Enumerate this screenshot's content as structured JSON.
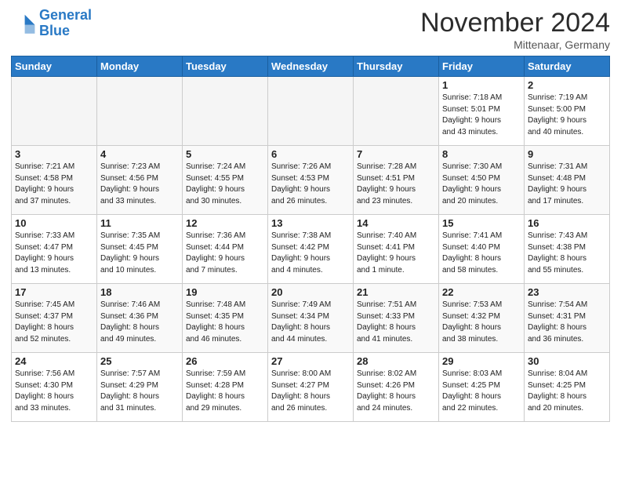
{
  "header": {
    "logo_line1": "General",
    "logo_line2": "Blue",
    "month_title": "November 2024",
    "location": "Mittenaar, Germany"
  },
  "weekdays": [
    "Sunday",
    "Monday",
    "Tuesday",
    "Wednesday",
    "Thursday",
    "Friday",
    "Saturday"
  ],
  "weeks": [
    [
      {
        "day": "",
        "info": ""
      },
      {
        "day": "",
        "info": ""
      },
      {
        "day": "",
        "info": ""
      },
      {
        "day": "",
        "info": ""
      },
      {
        "day": "",
        "info": ""
      },
      {
        "day": "1",
        "info": "Sunrise: 7:18 AM\nSunset: 5:01 PM\nDaylight: 9 hours\nand 43 minutes."
      },
      {
        "day": "2",
        "info": "Sunrise: 7:19 AM\nSunset: 5:00 PM\nDaylight: 9 hours\nand 40 minutes."
      }
    ],
    [
      {
        "day": "3",
        "info": "Sunrise: 7:21 AM\nSunset: 4:58 PM\nDaylight: 9 hours\nand 37 minutes."
      },
      {
        "day": "4",
        "info": "Sunrise: 7:23 AM\nSunset: 4:56 PM\nDaylight: 9 hours\nand 33 minutes."
      },
      {
        "day": "5",
        "info": "Sunrise: 7:24 AM\nSunset: 4:55 PM\nDaylight: 9 hours\nand 30 minutes."
      },
      {
        "day": "6",
        "info": "Sunrise: 7:26 AM\nSunset: 4:53 PM\nDaylight: 9 hours\nand 26 minutes."
      },
      {
        "day": "7",
        "info": "Sunrise: 7:28 AM\nSunset: 4:51 PM\nDaylight: 9 hours\nand 23 minutes."
      },
      {
        "day": "8",
        "info": "Sunrise: 7:30 AM\nSunset: 4:50 PM\nDaylight: 9 hours\nand 20 minutes."
      },
      {
        "day": "9",
        "info": "Sunrise: 7:31 AM\nSunset: 4:48 PM\nDaylight: 9 hours\nand 17 minutes."
      }
    ],
    [
      {
        "day": "10",
        "info": "Sunrise: 7:33 AM\nSunset: 4:47 PM\nDaylight: 9 hours\nand 13 minutes."
      },
      {
        "day": "11",
        "info": "Sunrise: 7:35 AM\nSunset: 4:45 PM\nDaylight: 9 hours\nand 10 minutes."
      },
      {
        "day": "12",
        "info": "Sunrise: 7:36 AM\nSunset: 4:44 PM\nDaylight: 9 hours\nand 7 minutes."
      },
      {
        "day": "13",
        "info": "Sunrise: 7:38 AM\nSunset: 4:42 PM\nDaylight: 9 hours\nand 4 minutes."
      },
      {
        "day": "14",
        "info": "Sunrise: 7:40 AM\nSunset: 4:41 PM\nDaylight: 9 hours\nand 1 minute."
      },
      {
        "day": "15",
        "info": "Sunrise: 7:41 AM\nSunset: 4:40 PM\nDaylight: 8 hours\nand 58 minutes."
      },
      {
        "day": "16",
        "info": "Sunrise: 7:43 AM\nSunset: 4:38 PM\nDaylight: 8 hours\nand 55 minutes."
      }
    ],
    [
      {
        "day": "17",
        "info": "Sunrise: 7:45 AM\nSunset: 4:37 PM\nDaylight: 8 hours\nand 52 minutes."
      },
      {
        "day": "18",
        "info": "Sunrise: 7:46 AM\nSunset: 4:36 PM\nDaylight: 8 hours\nand 49 minutes."
      },
      {
        "day": "19",
        "info": "Sunrise: 7:48 AM\nSunset: 4:35 PM\nDaylight: 8 hours\nand 46 minutes."
      },
      {
        "day": "20",
        "info": "Sunrise: 7:49 AM\nSunset: 4:34 PM\nDaylight: 8 hours\nand 44 minutes."
      },
      {
        "day": "21",
        "info": "Sunrise: 7:51 AM\nSunset: 4:33 PM\nDaylight: 8 hours\nand 41 minutes."
      },
      {
        "day": "22",
        "info": "Sunrise: 7:53 AM\nSunset: 4:32 PM\nDaylight: 8 hours\nand 38 minutes."
      },
      {
        "day": "23",
        "info": "Sunrise: 7:54 AM\nSunset: 4:31 PM\nDaylight: 8 hours\nand 36 minutes."
      }
    ],
    [
      {
        "day": "24",
        "info": "Sunrise: 7:56 AM\nSunset: 4:30 PM\nDaylight: 8 hours\nand 33 minutes."
      },
      {
        "day": "25",
        "info": "Sunrise: 7:57 AM\nSunset: 4:29 PM\nDaylight: 8 hours\nand 31 minutes."
      },
      {
        "day": "26",
        "info": "Sunrise: 7:59 AM\nSunset: 4:28 PM\nDaylight: 8 hours\nand 29 minutes."
      },
      {
        "day": "27",
        "info": "Sunrise: 8:00 AM\nSunset: 4:27 PM\nDaylight: 8 hours\nand 26 minutes."
      },
      {
        "day": "28",
        "info": "Sunrise: 8:02 AM\nSunset: 4:26 PM\nDaylight: 8 hours\nand 24 minutes."
      },
      {
        "day": "29",
        "info": "Sunrise: 8:03 AM\nSunset: 4:25 PM\nDaylight: 8 hours\nand 22 minutes."
      },
      {
        "day": "30",
        "info": "Sunrise: 8:04 AM\nSunset: 4:25 PM\nDaylight: 8 hours\nand 20 minutes."
      }
    ]
  ]
}
